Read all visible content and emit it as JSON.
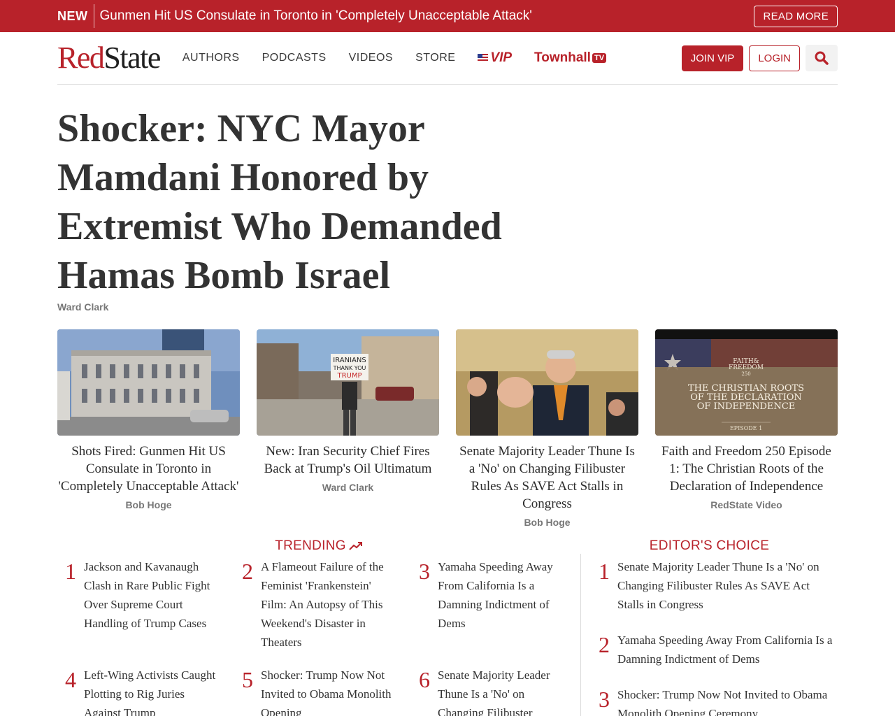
{
  "banner": {
    "tag": "NEW",
    "text": "Gunmen Hit US Consulate in Toronto in 'Completely Unacceptable Attack'",
    "button": "READ MORE"
  },
  "header": {
    "logo_part1": "Red",
    "logo_part2": "State",
    "nav": [
      "AUTHORS",
      "PODCASTS",
      "VIDEOS",
      "STORE"
    ],
    "vip_label": "VIP",
    "townhall_label": "Townhall",
    "townhall_badge": "TV",
    "join_label": "JOIN VIP",
    "login_label": "LOGIN",
    "search_icon": "search-icon"
  },
  "headline": {
    "title": "Shocker: NYC Mayor Mamdani Honored by Extremist Who Demanded Hamas Bomb Israel",
    "author": "Ward Clark"
  },
  "cards": [
    {
      "title": "Shots Fired: Gunmen Hit US Consulate in Toronto in 'Completely Unacceptable Attack'",
      "author": "Bob Hoge"
    },
    {
      "title": "New: Iran Security Chief Fires Back at Trump's Oil Ultimatum",
      "author": "Ward Clark",
      "sign_line1": "IRANIANS",
      "sign_line2": "THANK YOU",
      "sign_line3": "TRUMP"
    },
    {
      "title": "Senate Majority Leader Thune Is a 'No' on Changing Filibuster Rules As SAVE Act Stalls in Congress",
      "author": "Bob Hoge"
    },
    {
      "title": "Faith and Freedom 250 Episode 1: The Christian Roots of the Declaration of Independence",
      "author": "RedState Video",
      "overlay_brand1": "FAITH&",
      "overlay_brand2": "FREEDOM",
      "overlay_brand3": "250",
      "overlay_title1": "THE CHRISTIAN ROOTS",
      "overlay_title2": "OF THE DECLARATION",
      "overlay_title3": "OF INDEPENDENCE",
      "overlay_episode": "EPISODE 1"
    }
  ],
  "trending": {
    "title": "TRENDING",
    "items": [
      {
        "num": "1",
        "text": "Jackson and Kavanaugh Clash in Rare Public Fight Over Supreme Court Handling of Trump Cases"
      },
      {
        "num": "2",
        "text": "A Flameout Failure of the Feminist 'Frankenstein' Film: An Autopsy of This Weekend's Disaster in Theaters"
      },
      {
        "num": "3",
        "text": "Yamaha Speeding Away From California Is a Damning Indictment of Dems"
      },
      {
        "num": "4",
        "text": "Left-Wing Activists Caught Plotting to Rig Juries Against Trump"
      },
      {
        "num": "5",
        "text": "Shocker: Trump Now Not Invited to Obama Monolith Opening"
      },
      {
        "num": "6",
        "text": "Senate Majority Leader Thune Is a 'No' on Changing Filibuster"
      }
    ]
  },
  "editors_choice": {
    "title": "EDITOR'S CHOICE",
    "items": [
      {
        "num": "1",
        "text": "Senate Majority Leader Thune Is a 'No' on Changing Filibuster Rules As SAVE Act Stalls in Congress"
      },
      {
        "num": "2",
        "text": "Yamaha Speeding Away From California Is a Damning Indictment of Dems"
      },
      {
        "num": "3",
        "text": "Shocker: Trump Now Not Invited to Obama Monolith Opening Ceremony"
      }
    ]
  },
  "colors": {
    "brand_red": "#b8222a",
    "text": "#333333",
    "muted": "#777777"
  }
}
